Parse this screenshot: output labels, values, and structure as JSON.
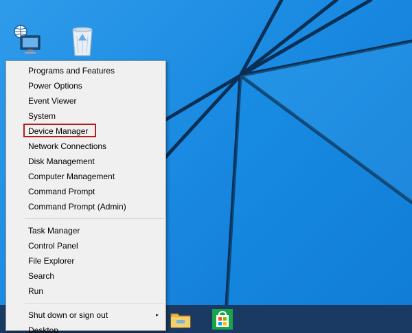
{
  "desktop": {
    "icons": [
      {
        "name": "network-computer-icon"
      },
      {
        "name": "recycle-bin-icon"
      }
    ]
  },
  "context_menu": {
    "group1": [
      {
        "label": "Programs and Features"
      },
      {
        "label": "Power Options"
      },
      {
        "label": "Event Viewer"
      },
      {
        "label": "System"
      },
      {
        "label": "Device Manager",
        "highlighted": true
      },
      {
        "label": "Network Connections"
      },
      {
        "label": "Disk Management"
      },
      {
        "label": "Computer Management"
      },
      {
        "label": "Command Prompt"
      },
      {
        "label": "Command Prompt (Admin)"
      }
    ],
    "group2": [
      {
        "label": "Task Manager"
      },
      {
        "label": "Control Panel"
      },
      {
        "label": "File Explorer"
      },
      {
        "label": "Search"
      },
      {
        "label": "Run"
      }
    ],
    "group3": [
      {
        "label": "Shut down or sign out",
        "submenu_glyph": "▸"
      },
      {
        "label": "Desktop"
      }
    ],
    "highlight_color": "#b71c1c"
  },
  "taskbar": {
    "color": "#1b3a63",
    "pinned": [
      {
        "name": "file-explorer-icon"
      },
      {
        "name": "store-icon"
      }
    ]
  }
}
